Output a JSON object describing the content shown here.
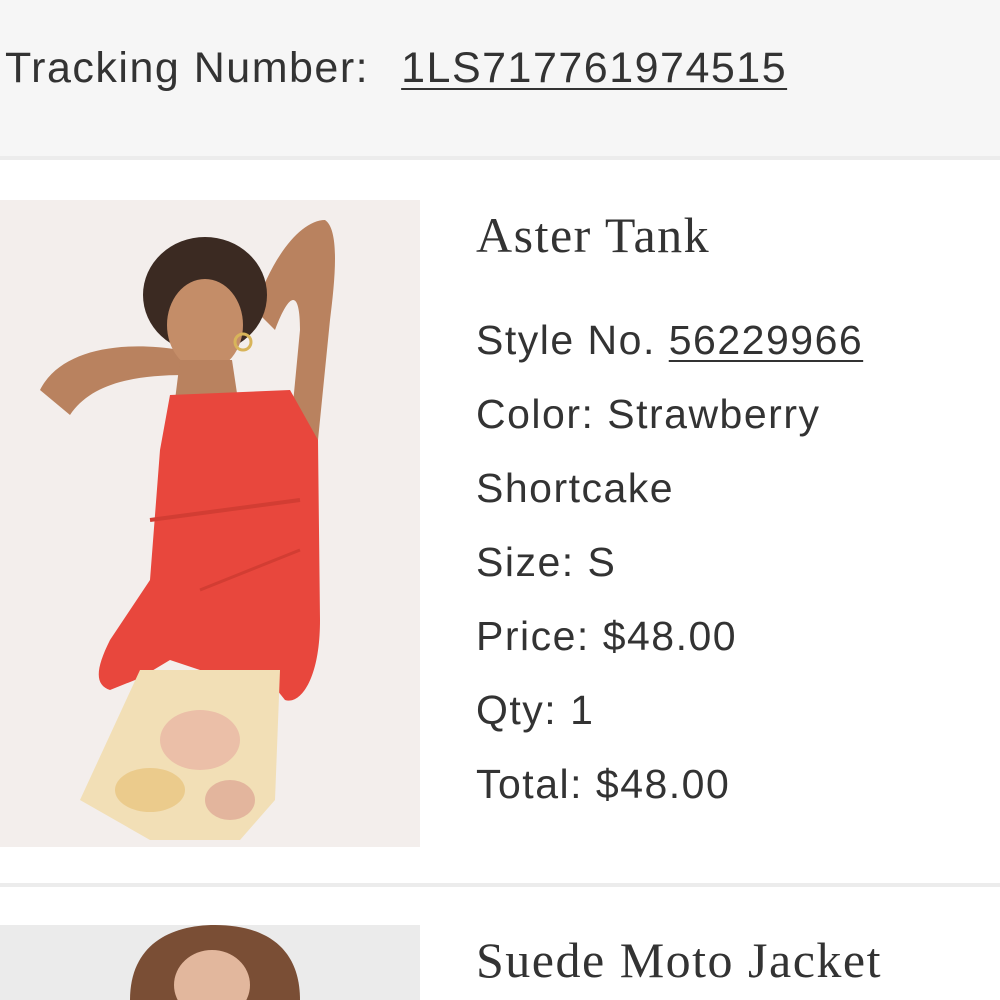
{
  "tracking": {
    "label": "Tracking Number:",
    "number": "1LS717761974515"
  },
  "items": [
    {
      "title": "Aster Tank",
      "style_label": "Style No.",
      "style_number": "56229966",
      "color_line_1": "Color: Strawberry",
      "color_line_2": "Shortcake",
      "size": "Size: S",
      "price": "Price: $48.00",
      "qty": "Qty: 1",
      "total": "Total: $48.00",
      "image_icon": "product-photo-red-tank-top"
    },
    {
      "title": "Suede Moto Jacket",
      "image_icon": "product-photo-jacket"
    }
  ],
  "colors": {
    "text": "#333333",
    "tracking_bg": "#f6f6f6",
    "divider": "#ececec",
    "tank_red": "#e8473d"
  }
}
